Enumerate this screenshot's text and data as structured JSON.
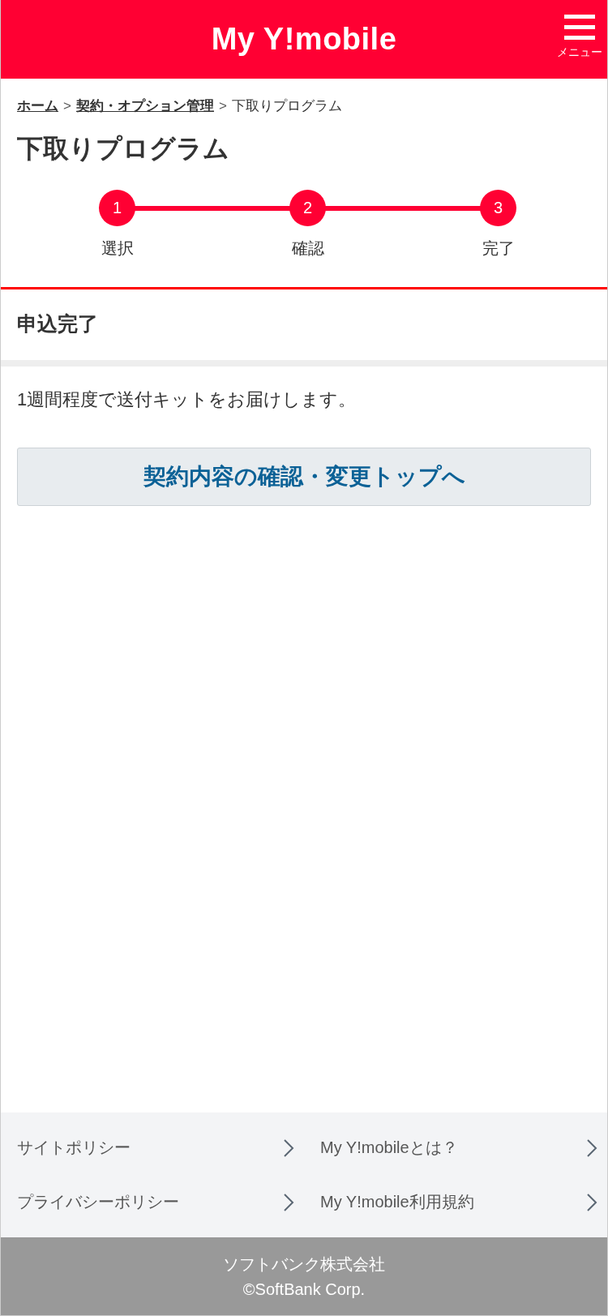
{
  "header": {
    "logo": "My Y!mobile",
    "menu_label": "メニュー"
  },
  "breadcrumbs": [
    {
      "label": "ホーム",
      "link": true
    },
    {
      "separator": ">",
      "label": "契約・オプション管理",
      "link": true
    },
    {
      "separator": ">",
      "label": "下取りプログラム",
      "link": false
    }
  ],
  "page_title": "下取りプログラム",
  "steps": [
    {
      "number": "1",
      "label": "選択"
    },
    {
      "number": "2",
      "label": "確認"
    },
    {
      "number": "3",
      "label": "完了"
    }
  ],
  "section_title": "申込完了",
  "message": "1週間程度で送付キットをお届けします。",
  "action_button": "契約内容の確認・変更トップへ",
  "footer_links": [
    {
      "label": "サイトポリシー"
    },
    {
      "label": "My Y!mobileとは？"
    },
    {
      "label": "プライバシーポリシー"
    },
    {
      "label": "My Y!mobile利用規約"
    }
  ],
  "copyright": [
    "ソフトバンク株式会社",
    "©SoftBank Corp."
  ]
}
